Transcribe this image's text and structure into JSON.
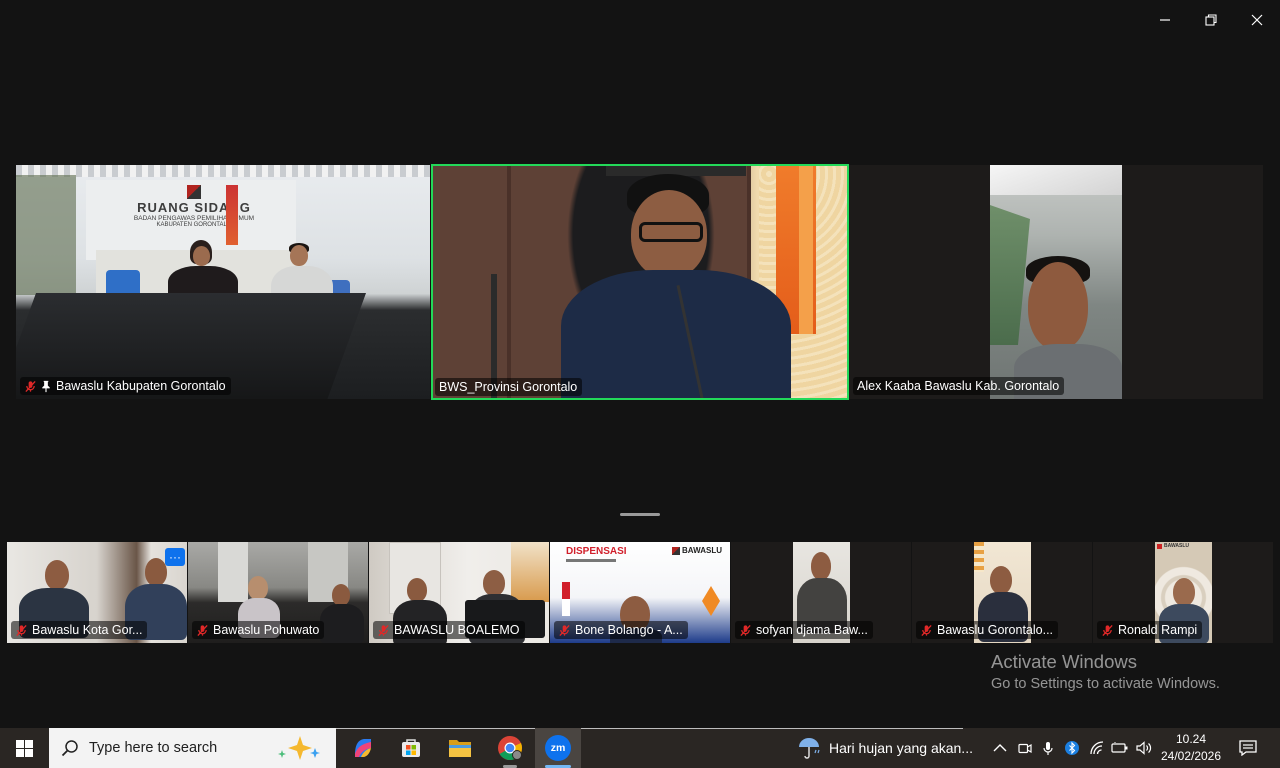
{
  "window": {
    "controls": [
      "minimize",
      "restore",
      "close"
    ]
  },
  "main_tiles": [
    {
      "name": "Bawaslu Kabupaten Gorontalo",
      "muted": true,
      "pinned": true,
      "sign_title": "RUANG SIDANG",
      "sign_line1": "BADAN PENGAWAS PEMILIHAN UMUM",
      "sign_line2": "KABUPATEN GORONTALO"
    },
    {
      "name": "BWS_Provinsi Gorontalo",
      "muted": false,
      "active_speaker": true
    },
    {
      "name": "Alex Kaaba Bawaslu Kab. Gorontalo",
      "muted": false
    }
  ],
  "strip_tiles": [
    {
      "name": "Bawaslu Kota Gor...",
      "muted": true,
      "more_label": "···"
    },
    {
      "name": "Bawaslu Pohuwato",
      "muted": true
    },
    {
      "name": "BAWASLU BOALEMO",
      "muted": true
    },
    {
      "name": "Bone Bolango - A...",
      "muted": true,
      "banner_title": "DISPENSASI",
      "banner_logo": "BAWASLU"
    },
    {
      "name": "sofyan djama Baw...",
      "muted": true
    },
    {
      "name": "Bawaslu Gorontalo...",
      "muted": true
    },
    {
      "name": "Ronald Rampi",
      "muted": true,
      "poster_logo": "BAWASLU"
    }
  ],
  "watermark": {
    "title": "Activate Windows",
    "subtitle": "Go to Settings to activate Windows."
  },
  "taskbar": {
    "search_placeholder": "Type here to search",
    "apps": [
      "copilot-icon",
      "store-icon",
      "file-explorer-icon",
      "chrome-icon",
      "zoom-icon"
    ],
    "zoom_label": "zm",
    "weather_text": "Hari hujan yang akan...",
    "time": "10.24",
    "date": "24/02/2026"
  },
  "colors": {
    "active_speaker_border": "#23d959",
    "muted_mic": "#e02828",
    "zoom_blue": "#0e72ed",
    "taskbar_bg": "#2a2623"
  }
}
